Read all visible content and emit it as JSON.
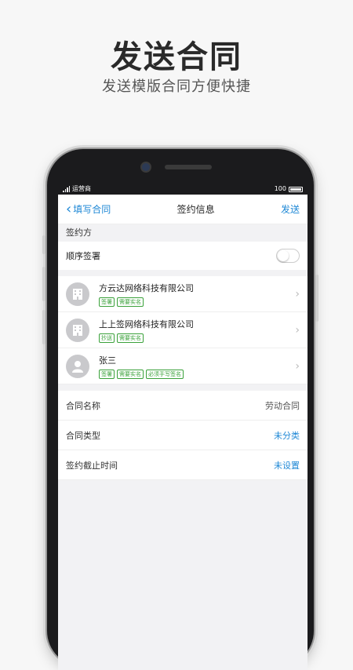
{
  "promo": {
    "title": "发送合同",
    "subtitle": "发送模版合同方便快捷"
  },
  "status_bar": {
    "carrier": "运营商",
    "battery": "100"
  },
  "nav": {
    "back_label": "填写合同",
    "title": "签约信息",
    "send_label": "发送"
  },
  "section": {
    "signers_title": "签约方",
    "sequential_label": "顺序签署",
    "sequential_enabled": false
  },
  "signers": [
    {
      "name": "方云达网络科技有限公司",
      "type": "company",
      "tags": [
        "签署",
        "需要实名"
      ]
    },
    {
      "name": "上上签网络科技有限公司",
      "type": "company",
      "tags": [
        "抄送",
        "需要实名"
      ]
    },
    {
      "name": "张三",
      "type": "person",
      "tags": [
        "签署",
        "需要实名",
        "必须手写签名"
      ]
    }
  ],
  "fields": [
    {
      "label": "合同名称",
      "value": "劳动合同",
      "style": "gray"
    },
    {
      "label": "合同类型",
      "value": "未分类",
      "style": "blue"
    },
    {
      "label": "签约截止时间",
      "value": "未设置",
      "style": "blue"
    }
  ],
  "colors": {
    "accent": "#1f88d6",
    "tag_green": "#3aa13a"
  }
}
